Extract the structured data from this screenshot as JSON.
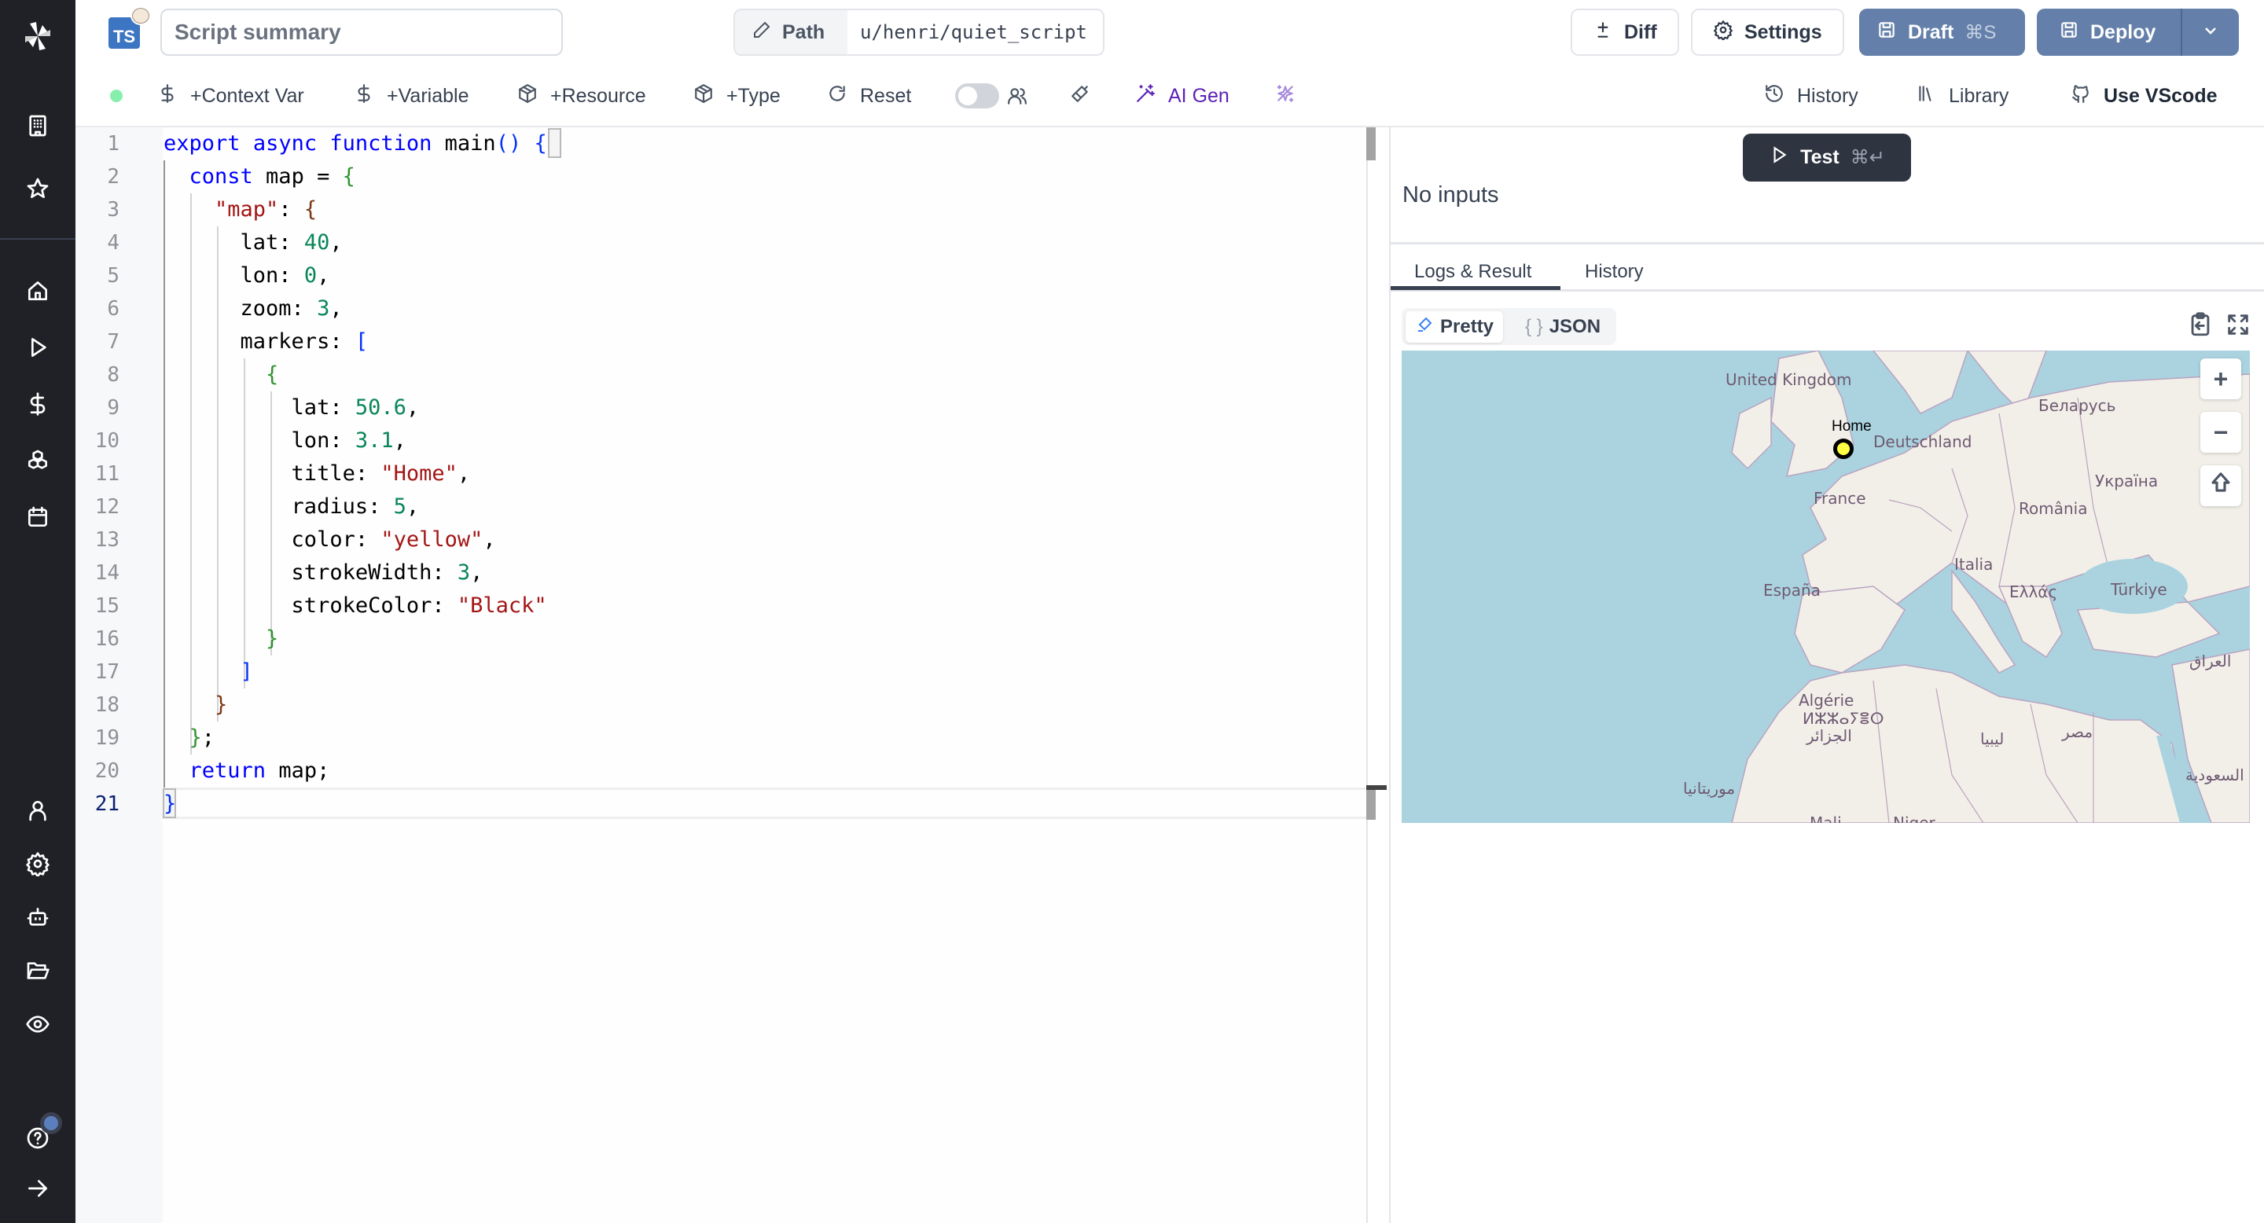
{
  "sidebar": {
    "logo": "windmill-logo",
    "top_items": [
      {
        "name": "workspace",
        "icon": "building-icon"
      },
      {
        "name": "favorites",
        "icon": "star-icon"
      }
    ],
    "main_items": [
      {
        "name": "home",
        "icon": "home-icon"
      },
      {
        "name": "runs",
        "icon": "play-icon"
      },
      {
        "name": "variables",
        "icon": "dollar-icon"
      },
      {
        "name": "resources",
        "icon": "boxes-icon"
      },
      {
        "name": "schedules",
        "icon": "calendar-icon"
      }
    ],
    "bottom_items": [
      {
        "name": "user",
        "icon": "user-icon"
      },
      {
        "name": "settings",
        "icon": "gear-icon"
      },
      {
        "name": "workers",
        "icon": "bot-icon"
      },
      {
        "name": "folders",
        "icon": "folder-open-icon"
      },
      {
        "name": "audit",
        "icon": "eye-icon"
      },
      {
        "name": "help",
        "icon": "help-icon"
      },
      {
        "name": "collapse",
        "icon": "arrow-right-icon"
      }
    ]
  },
  "header": {
    "language_badge": "TS",
    "summary_placeholder": "Script summary",
    "summary_value": "",
    "path_label": "Path",
    "path_value": "u/henri/quiet_script",
    "diff_label": "Diff",
    "settings_label": "Settings",
    "draft_label": "Draft",
    "draft_shortcut": "⌘S",
    "deploy_label": "Deploy"
  },
  "toolbar": {
    "status_color": "#86efac",
    "context_var": "+Context Var",
    "variable": "+Variable",
    "resource": "+Resource",
    "type": "+Type",
    "reset": "Reset",
    "collab_toggle": false,
    "ai_gen": "AI Gen",
    "history": "History",
    "library": "Library",
    "use_vscode": "Use VScode"
  },
  "editor": {
    "active_line": 21,
    "lines": [
      "export async function main() {",
      "  const map = {",
      "    \"map\": {",
      "      lat: 40,",
      "      lon: 0,",
      "      zoom: 3,",
      "      markers: [",
      "        {",
      "          lat: 50.6,",
      "          lon: 3.1,",
      "          title: \"Home\",",
      "          radius: 5,",
      "          color: \"yellow\",",
      "          strokeWidth: 3,",
      "          strokeColor: \"Black\"",
      "        }",
      "      ]",
      "    }",
      "  };",
      "  return map;",
      "}"
    ]
  },
  "right": {
    "test_label": "Test",
    "test_shortcut": "⌘↵",
    "no_inputs": "No inputs",
    "tabs": [
      "Logs & Result",
      "History"
    ],
    "active_tab": "Logs & Result",
    "view_modes": [
      "Pretty",
      "JSON"
    ],
    "active_view": "Pretty",
    "map": {
      "center": {
        "lat": 40,
        "lon": 0
      },
      "zoom": 3,
      "marker": {
        "lat": 50.6,
        "lon": 3.1,
        "title": "Home",
        "color": "yellow",
        "stroke_color": "Black"
      },
      "labels": [
        "United Kingdom",
        "Беларусь",
        "Deutschland",
        "Україна",
        "France",
        "România",
        "España",
        "Italia",
        "Ελλάς",
        "Türkiye",
        "العراق",
        "Algérie",
        "ⵍⵣⵣⴰⵢⴻⵔ",
        "الجزائر",
        "ليبيا",
        "مصر",
        "السعودية",
        "موريتانيا",
        "Mali",
        "Niger"
      ],
      "controls": {
        "zoom_in": "+",
        "zoom_out": "−"
      }
    }
  }
}
